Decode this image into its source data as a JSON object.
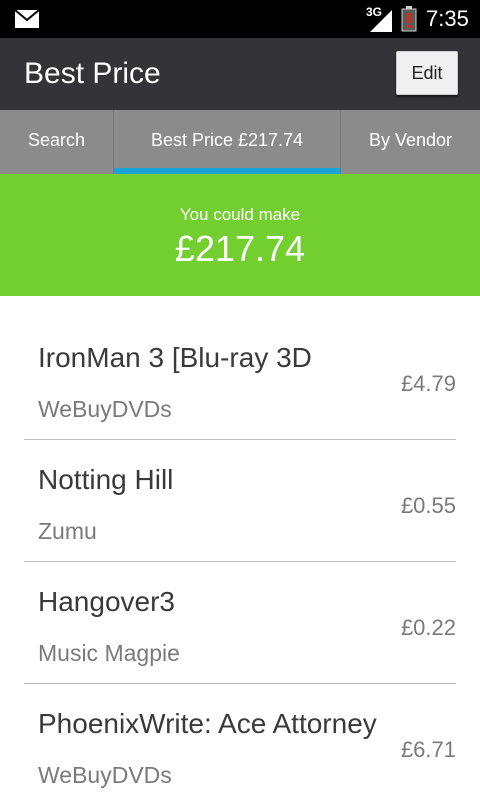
{
  "status_bar": {
    "network": "3G",
    "time": "7:35",
    "notification_icon": "mail-icon",
    "signal_icon": "signal-icon",
    "battery_icon": "battery-low-icon"
  },
  "action_bar": {
    "title": "Best Price",
    "edit_label": "Edit"
  },
  "tabs": [
    {
      "label": "Search"
    },
    {
      "label": "Best Price £217.74",
      "selected": true
    },
    {
      "label": "By Vendor"
    }
  ],
  "banner": {
    "caption": "You could make",
    "amount": "£217.74",
    "color": "#72cf2f"
  },
  "items": [
    {
      "name": "IronMan 3 [Blu-ray 3D",
      "vendor": "WeBuyDVDs",
      "price": "£4.79"
    },
    {
      "name": "Notting Hill",
      "vendor": "Zumu",
      "price": "£0.55"
    },
    {
      "name": "Hangover3",
      "vendor": "Music Magpie",
      "price": "£0.22"
    },
    {
      "name": "PhoenixWrite: Ace Attorney",
      "vendor": "WeBuyDVDs",
      "price": "£6.71"
    }
  ],
  "colors": {
    "action_bar": "#333338",
    "tab_bar": "#8b8b8b",
    "tab_indicator": "#1aa3d9",
    "banner": "#72cf2f"
  }
}
